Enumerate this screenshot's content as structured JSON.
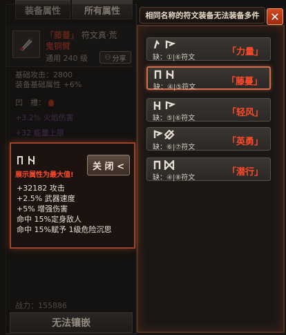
{
  "tabs": [
    "装备属性",
    "所有属性"
  ],
  "item": {
    "name": "「藤蔓」",
    "type": "符文真·荒",
    "subname": "鬼铜臂",
    "level": "通用 240 级",
    "share_label": "分享",
    "base_attack": "基础攻击：2800",
    "base_bonus": "装备基础属性 +6%",
    "socket_label": "凹　槽：",
    "stat_faded_1": "+3.2% 火焰伤害",
    "stat_faded_2": "+32 能量上限",
    "power": "战力：155886",
    "bottom_button": "无法镶嵌"
  },
  "header": {
    "title": "相同名称的符文装备无法装备多件",
    "close_icon": "close-x-icon"
  },
  "runes": [
    {
      "req": "缺：①|⑥符文",
      "name": "「力量」",
      "selected": false
    },
    {
      "req": "缺：④|⑤符文",
      "name": "「藤蔓」",
      "selected": true
    },
    {
      "req": "缺：⑤|⑥符文",
      "name": "「轻风」",
      "selected": false
    },
    {
      "req": "缺：⑥|⑦符文",
      "name": "「英勇」",
      "selected": false
    },
    {
      "req": "缺：④|⑧符文",
      "name": "「潜行」",
      "selected": false
    }
  ],
  "popup": {
    "warning": "展示属性为最大值!",
    "close_label": "关 闭 <",
    "lines": [
      "+32182 攻击",
      "+2.5% 武器速度",
      "+5% 增强伤害",
      "命中 15%定身敌人",
      "命中 15%赋予 1级危险沉思"
    ]
  },
  "colors": {
    "rune_name": "#ff4a2a",
    "accent_border": "#a0452c",
    "close_button": "#c23a18"
  }
}
